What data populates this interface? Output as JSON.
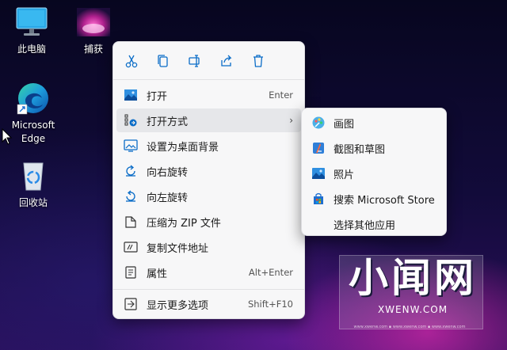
{
  "desktop": {
    "icons": [
      {
        "label": "此电脑"
      },
      {
        "label": "捕获"
      },
      {
        "label": "Microsoft Edge"
      },
      {
        "label": "回收站"
      }
    ]
  },
  "context_menu": {
    "toolbar": [
      {
        "icon": "cut-icon"
      },
      {
        "icon": "copy-icon"
      },
      {
        "icon": "rename-icon"
      },
      {
        "icon": "share-icon"
      },
      {
        "icon": "delete-icon"
      }
    ],
    "items": [
      {
        "label": "打开",
        "shortcut": "Enter",
        "icon": "image-icon"
      },
      {
        "label": "打开方式",
        "shortcut": "",
        "icon": "open-with-icon",
        "has_submenu": true,
        "highlighted": true
      },
      {
        "label": "设置为桌面背景",
        "shortcut": "",
        "icon": "wallpaper-icon"
      },
      {
        "label": "向右旋转",
        "shortcut": "",
        "icon": "rotate-right-icon"
      },
      {
        "label": "向左旋转",
        "shortcut": "",
        "icon": "rotate-left-icon"
      },
      {
        "label": "压缩为 ZIP 文件",
        "shortcut": "",
        "icon": "zip-icon"
      },
      {
        "label": "复制文件地址",
        "shortcut": "",
        "icon": "copy-path-icon"
      },
      {
        "label": "属性",
        "shortcut": "Alt+Enter",
        "icon": "properties-icon"
      },
      {
        "label": "显示更多选项",
        "shortcut": "Shift+F10",
        "icon": "more-options-icon"
      }
    ]
  },
  "submenu": {
    "items": [
      {
        "label": "画图",
        "icon": "paint-icon"
      },
      {
        "label": "截图和草图",
        "icon": "snip-sketch-icon"
      },
      {
        "label": "照片",
        "icon": "photos-icon"
      },
      {
        "label": "搜索 Microsoft Store",
        "icon": "store-icon"
      },
      {
        "label": "选择其他应用",
        "icon": ""
      }
    ]
  },
  "watermark": {
    "title": "小闻网",
    "url": "XWENW.COM",
    "tiny": "www.xwenw.com ▪ www.xwenw.com ▪ www.xwenw.com"
  },
  "colors": {
    "accent": "#0a6cc7",
    "menu_bg": "#f7f7f8",
    "highlight": "#e6e7ea"
  }
}
